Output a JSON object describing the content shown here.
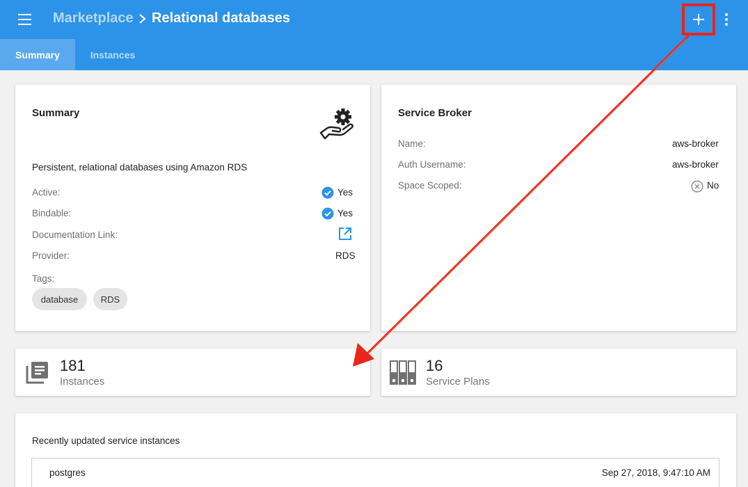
{
  "header": {
    "breadcrumb_root": "Marketplace",
    "breadcrumb_current": "Relational databases",
    "menu_icon": "hamburger-menu-icon",
    "add_icon": "plus-icon",
    "more_icon": "more-vert-icon",
    "accent_color": "#2c93e8"
  },
  "tabs": [
    {
      "label": "Summary",
      "active": true
    },
    {
      "label": "Instances",
      "active": false
    }
  ],
  "summary_card": {
    "title": "Summary",
    "icon": "service-hand-gear-icon",
    "description": "Persistent, relational databases using Amazon RDS",
    "active_label": "Active:",
    "active_value": "Yes",
    "bindable_label": "Bindable:",
    "bindable_value": "Yes",
    "doc_label": "Documentation Link:",
    "doc_icon": "open-in-new-icon",
    "provider_label": "Provider:",
    "provider_value": "RDS",
    "tags_label": "Tags:",
    "tags": [
      "database",
      "RDS"
    ]
  },
  "broker_card": {
    "title": "Service Broker",
    "name_label": "Name:",
    "name_value": "aws-broker",
    "auth_label": "Auth Username:",
    "auth_value": "aws-broker",
    "scoped_label": "Space Scoped:",
    "scoped_value": "No"
  },
  "stats": {
    "instances_count": "181",
    "instances_label": "Instances",
    "plans_count": "16",
    "plans_label": "Service Plans"
  },
  "recent": {
    "title": "Recently updated service instances",
    "rows": [
      {
        "name": "postgres",
        "date": "Sep 27, 2018, 9:47:10 AM"
      }
    ]
  },
  "annotation": {
    "highlight_color": "#e8261b"
  }
}
